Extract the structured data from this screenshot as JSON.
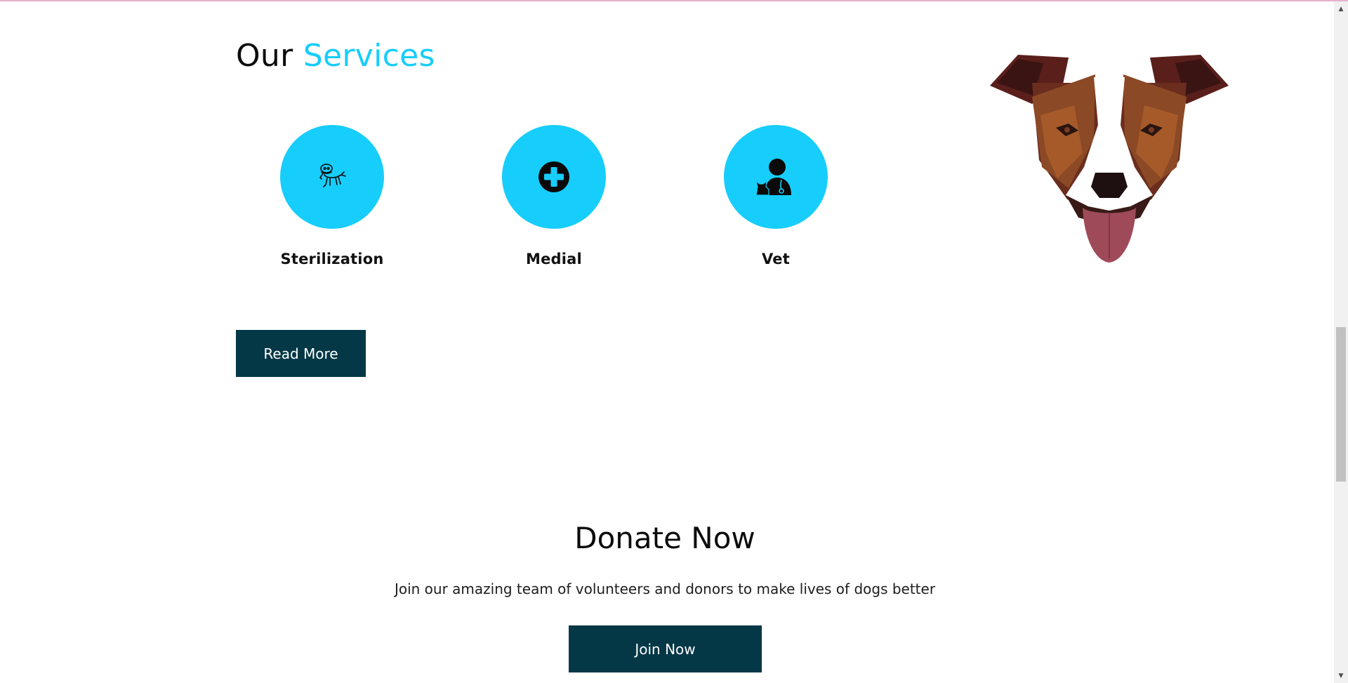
{
  "colors": {
    "accent": "#17cdfb",
    "button_bg": "#053847",
    "icon_dark": "#0a0a0a"
  },
  "services": {
    "title_plain": "Our",
    "title_accent": "Services",
    "items": [
      {
        "label": "Sterilization",
        "icon": "dog-cone-icon"
      },
      {
        "label": "Medial",
        "icon": "medical-cross-icon"
      },
      {
        "label": "Vet",
        "icon": "veterinarian-icon"
      }
    ],
    "read_more_label": "Read More"
  },
  "donate": {
    "title": "Donate Now",
    "text": "Join our amazing team of volunteers and donors to make lives of dogs better",
    "join_label": "Join Now"
  },
  "illustration": {
    "icon": "dog-face-illustration"
  },
  "scrollbar": {
    "up_icon": "scroll-up-arrow-icon",
    "down_icon": "scroll-down-arrow-icon"
  }
}
